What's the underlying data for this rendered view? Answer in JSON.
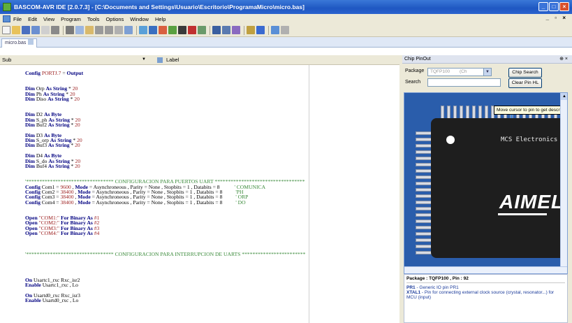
{
  "window": {
    "title": "BASCOM-AVR IDE [2.0.7.3] - [C:\\Documents and Settings\\Usuario\\Escritorio\\ProgramaMicro\\micro.bas]",
    "buttons": {
      "min": "_",
      "max": "□",
      "close": "×"
    }
  },
  "menu": {
    "items": [
      "File",
      "Edit",
      "View",
      "Program",
      "Tools",
      "Options",
      "Window",
      "Help"
    ],
    "mdi_buttons": "_ ▫ ×"
  },
  "tab": {
    "label": "micro.bas"
  },
  "combo": {
    "sub": "Sub",
    "label": "Label"
  },
  "code_lines": [
    [
      {
        "c": "kw",
        "t": "Config "
      },
      {
        "c": "st",
        "t": "PORTJ.7"
      },
      {
        "c": "plain",
        "t": " = "
      },
      {
        "c": "kw",
        "t": "Output"
      }
    ],
    [],
    [],
    [
      {
        "c": "kw",
        "t": "Dim "
      },
      {
        "c": "plain",
        "t": "Orp "
      },
      {
        "c": "kw",
        "t": "As String"
      },
      {
        "c": "plain",
        "t": " * "
      },
      {
        "c": "st",
        "t": "20"
      }
    ],
    [
      {
        "c": "kw",
        "t": "Dim "
      },
      {
        "c": "plain",
        "t": "Ph "
      },
      {
        "c": "kw",
        "t": "As String"
      },
      {
        "c": "plain",
        "t": " * "
      },
      {
        "c": "st",
        "t": "20"
      }
    ],
    [
      {
        "c": "kw",
        "t": "Dim "
      },
      {
        "c": "plain",
        "t": "Diso "
      },
      {
        "c": "kw",
        "t": "As String"
      },
      {
        "c": "plain",
        "t": " * "
      },
      {
        "c": "st",
        "t": "20"
      }
    ],
    [],
    [],
    [
      {
        "c": "kw",
        "t": "Dim "
      },
      {
        "c": "plain",
        "t": "D2 "
      },
      {
        "c": "kw",
        "t": "As Byte"
      }
    ],
    [
      {
        "c": "kw",
        "t": "Dim "
      },
      {
        "c": "plain",
        "t": "S_ph "
      },
      {
        "c": "kw",
        "t": "As String"
      },
      {
        "c": "plain",
        "t": " * "
      },
      {
        "c": "st",
        "t": "20"
      }
    ],
    [
      {
        "c": "kw",
        "t": "Dim "
      },
      {
        "c": "plain",
        "t": "Buf2 "
      },
      {
        "c": "kw",
        "t": "As String"
      },
      {
        "c": "plain",
        "t": " * "
      },
      {
        "c": "st",
        "t": "20"
      }
    ],
    [],
    [
      {
        "c": "kw",
        "t": "Dim "
      },
      {
        "c": "plain",
        "t": "D3 "
      },
      {
        "c": "kw",
        "t": "As Byte"
      }
    ],
    [
      {
        "c": "kw",
        "t": "Dim "
      },
      {
        "c": "plain",
        "t": "S_orp "
      },
      {
        "c": "kw",
        "t": "As String"
      },
      {
        "c": "plain",
        "t": " * "
      },
      {
        "c": "st",
        "t": "20"
      }
    ],
    [
      {
        "c": "kw",
        "t": "Dim "
      },
      {
        "c": "plain",
        "t": "Buf3 "
      },
      {
        "c": "kw",
        "t": "As String"
      },
      {
        "c": "plain",
        "t": " * "
      },
      {
        "c": "st",
        "t": "20"
      }
    ],
    [],
    [
      {
        "c": "kw",
        "t": "Dim "
      },
      {
        "c": "plain",
        "t": "D4 "
      },
      {
        "c": "kw",
        "t": "As Byte"
      }
    ],
    [
      {
        "c": "kw",
        "t": "Dim "
      },
      {
        "c": "plain",
        "t": "S_do "
      },
      {
        "c": "kw",
        "t": "As String"
      },
      {
        "c": "plain",
        "t": " * "
      },
      {
        "c": "st",
        "t": "20"
      }
    ],
    [
      {
        "c": "kw",
        "t": "Dim "
      },
      {
        "c": "plain",
        "t": "Buf4 "
      },
      {
        "c": "kw",
        "t": "As String"
      },
      {
        "c": "plain",
        "t": " * "
      },
      {
        "c": "st",
        "t": "20"
      }
    ],
    [],
    [],
    [
      {
        "c": "cm",
        "t": "'********************************* CONFIGURACION PARA PUERTOS UART **********************************"
      }
    ],
    [
      {
        "c": "kw",
        "t": "Config "
      },
      {
        "c": "plain",
        "t": "Com1 = "
      },
      {
        "c": "st",
        "t": "9600"
      },
      {
        "c": "plain",
        "t": " , "
      },
      {
        "c": "kw",
        "t": "Mode"
      },
      {
        "c": "plain",
        "t": " = Asynchroneous , Parity = None , Stopbits = 1 , Databits = 8           "
      },
      {
        "c": "cm",
        "t": "' COMUNICA"
      }
    ],
    [
      {
        "c": "kw",
        "t": "Config "
      },
      {
        "c": "plain",
        "t": "Com2 = "
      },
      {
        "c": "st",
        "t": "38400"
      },
      {
        "c": "plain",
        "t": " , "
      },
      {
        "c": "kw",
        "t": "Mode"
      },
      {
        "c": "plain",
        "t": " = Asynchroneous , Parity = None , Stopbits = 1 , Databits = 8          "
      },
      {
        "c": "cm",
        "t": "'PH"
      }
    ],
    [
      {
        "c": "kw",
        "t": "Config "
      },
      {
        "c": "plain",
        "t": "Com3 = "
      },
      {
        "c": "st",
        "t": "38400"
      },
      {
        "c": "plain",
        "t": " , "
      },
      {
        "c": "kw",
        "t": "Mode"
      },
      {
        "c": "plain",
        "t": " = Asynchroneous , Parity = None , Stopbits = 1 , Databits = 8          "
      },
      {
        "c": "cm",
        "t": "' ORP"
      }
    ],
    [
      {
        "c": "kw",
        "t": "Config "
      },
      {
        "c": "plain",
        "t": "Com4 = "
      },
      {
        "c": "st",
        "t": "38400"
      },
      {
        "c": "plain",
        "t": " , "
      },
      {
        "c": "kw",
        "t": "Mode"
      },
      {
        "c": "plain",
        "t": " = Asynchroneous , Parity = None , Stopbits = 1 , Databits = 8          "
      },
      {
        "c": "cm",
        "t": "' DO"
      }
    ],
    [],
    [],
    [
      {
        "c": "kw",
        "t": "Open "
      },
      {
        "c": "st",
        "t": "\"COM1:\""
      },
      {
        "c": "kw",
        "t": " For Binary As "
      },
      {
        "c": "st",
        "t": "#1"
      }
    ],
    [
      {
        "c": "kw",
        "t": "Open "
      },
      {
        "c": "st",
        "t": "\"COM2:\""
      },
      {
        "c": "kw",
        "t": " For Binary As "
      },
      {
        "c": "st",
        "t": "#2"
      }
    ],
    [
      {
        "c": "kw",
        "t": "Open "
      },
      {
        "c": "st",
        "t": "\"COM3:\""
      },
      {
        "c": "kw",
        "t": " For Binary As "
      },
      {
        "c": "st",
        "t": "#3"
      }
    ],
    [
      {
        "c": "kw",
        "t": "Open "
      },
      {
        "c": "st",
        "t": "\"COM4:\""
      },
      {
        "c": "kw",
        "t": " For Binary As "
      },
      {
        "c": "st",
        "t": "#4"
      }
    ],
    [],
    [],
    [],
    [
      {
        "c": "cm",
        "t": "'********************************* CONFIGURACION PARA INTERRUPCION DE UARTS ************************"
      }
    ],
    [],
    [],
    [],
    [],
    [
      {
        "c": "kw",
        "t": "On "
      },
      {
        "c": "plain",
        "t": "Usartc1_rxc Rxc_isr2"
      }
    ],
    [
      {
        "c": "kw",
        "t": "Enable "
      },
      {
        "c": "plain",
        "t": "Usartc1_rxc , Lo"
      }
    ],
    [],
    [
      {
        "c": "kw",
        "t": "On "
      },
      {
        "c": "plain",
        "t": "Usartd0_rxc Rxc_isr3"
      }
    ],
    [
      {
        "c": "kw",
        "t": "Enable "
      },
      {
        "c": "plain",
        "t": "Usartd0_rxc , Lo"
      }
    ]
  ],
  "chip_panel": {
    "title": "Chip PinOut",
    "close": "⊕ ×",
    "package_label": "Package",
    "package_value": "TQFP100",
    "package_extra": "(Ch",
    "search_label": "Search",
    "chip_search_button": "Chip Search",
    "clear_button": "Clear Pin HL",
    "tooltip": "Move cursor to pin to get description",
    "chip_brand": "MCS Electronics",
    "chip_logo": "AIMEL",
    "info_header": "Package : TQFP100 , Pin : 92",
    "info_lines": [
      {
        "name": "PR1",
        "desc": " - Generic IO pin PR1"
      },
      {
        "name": "XTAL1",
        "desc": " - Pin for connecting external clock source (crystal, resonator...) for MCU (input)"
      }
    ]
  }
}
